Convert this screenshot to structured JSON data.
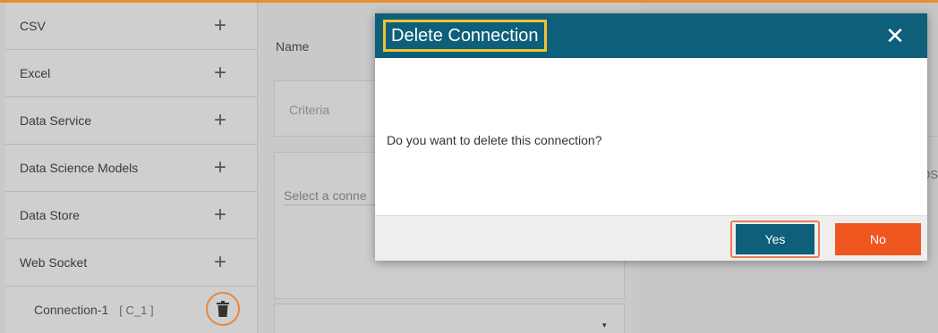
{
  "colors": {
    "accent_line": "#e8902f",
    "modal_header": "#0e5f7a",
    "yes_button": "#0e5f7a",
    "no_button": "#f0561f",
    "title_highlight": "#f2c230",
    "annotation_ring": "#ec7c55"
  },
  "sidebar": {
    "items": [
      {
        "label": "CSV",
        "icon": "plus-icon"
      },
      {
        "label": "Excel",
        "icon": "plus-icon"
      },
      {
        "label": "Data Service",
        "icon": "plus-icon"
      },
      {
        "label": "Data Science Models",
        "icon": "plus-icon"
      },
      {
        "label": "Data Store",
        "icon": "plus-icon"
      },
      {
        "label": "Web Socket",
        "icon": "plus-icon"
      }
    ],
    "plus_glyph": "+",
    "connection": {
      "name": "Connection-1",
      "code": "[ C_1 ]",
      "action_icon": "trash-icon"
    }
  },
  "form": {
    "name_label": "Name",
    "criteria_placeholder": "Criteria",
    "select_placeholder": "Select a conne",
    "dropdown_caret": "▾",
    "right_cut_text": "DS"
  },
  "modal": {
    "title": "Delete Connection",
    "close_glyph": "✕",
    "message": "Do you want to delete this connection?",
    "yes_label": "Yes",
    "no_label": "No"
  }
}
